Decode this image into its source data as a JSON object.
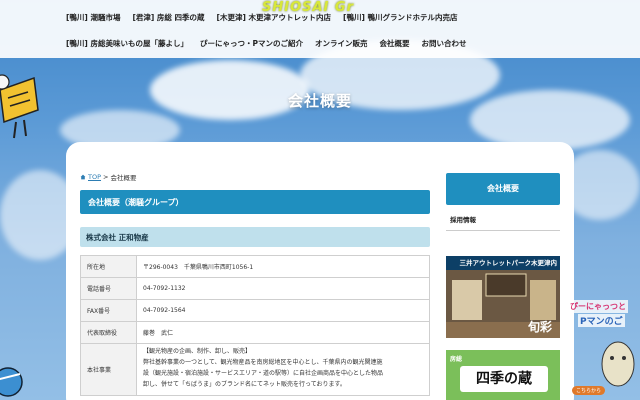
{
  "nav": {
    "logo": "SHIOSAI Gr",
    "row1": [
      "[鴨川] 潮騒市場",
      "[君津] 房総 四季の蔵",
      "[木更津] 木更津アウトレット内店",
      "[鴨川] 鴨川グランドホテル内売店"
    ],
    "row2": [
      "[鴨川] 房総美味いもの屋「藤よし」",
      "ぴーにゃっつ・Pマンのご紹介",
      "オンライン販売",
      "会社概要",
      "お問い合わせ"
    ]
  },
  "hero": {
    "title": "会社概要"
  },
  "breadcrumb": {
    "home": "TOP",
    "sep": ">",
    "current": "会社概要"
  },
  "section": {
    "heading": "会社概要（潮騒グループ）",
    "company_name": "株式会社 正和物産"
  },
  "table": [
    {
      "key": "所在地",
      "value": "〒296-0043　千葉県鴨川市西町1056-1"
    },
    {
      "key": "電話番号",
      "value": "04-7092-1132"
    },
    {
      "key": "FAX番号",
      "value": "04-7092-1564"
    },
    {
      "key": "代表取締役",
      "value": "藤巻　武仁"
    }
  ],
  "business": {
    "key": "本社事業",
    "lines": [
      "【観光物産の企画、制作、卸し、販売】",
      "弊社基幹事業の一つとして、観光物産品を南房総地区を中心とし、千葉県内の観光関連施",
      "設（観光施設・宿泊施設・サービスエリア・道の駅等）に自社企画商品を中心とした物品",
      "卸し、併せて「ちばうま」のブランド名にてネット販売を行っております。"
    ]
  },
  "sidebar": {
    "heading": "会社概要",
    "link": "採用情報",
    "banner1_title": "三井アウトレットパーク木更津内",
    "banner1_shop": "旬彩",
    "banner2_title": "四季の蔵",
    "banner2_sub": "房総"
  },
  "promo": {
    "line1": "ぴーにゃっつと",
    "line2": "Pマンのご",
    "more": "こちらから"
  },
  "colors": {
    "accent": "#1f8fbf",
    "sub_bg": "#bfe0ec",
    "link": "#2d7db3"
  }
}
